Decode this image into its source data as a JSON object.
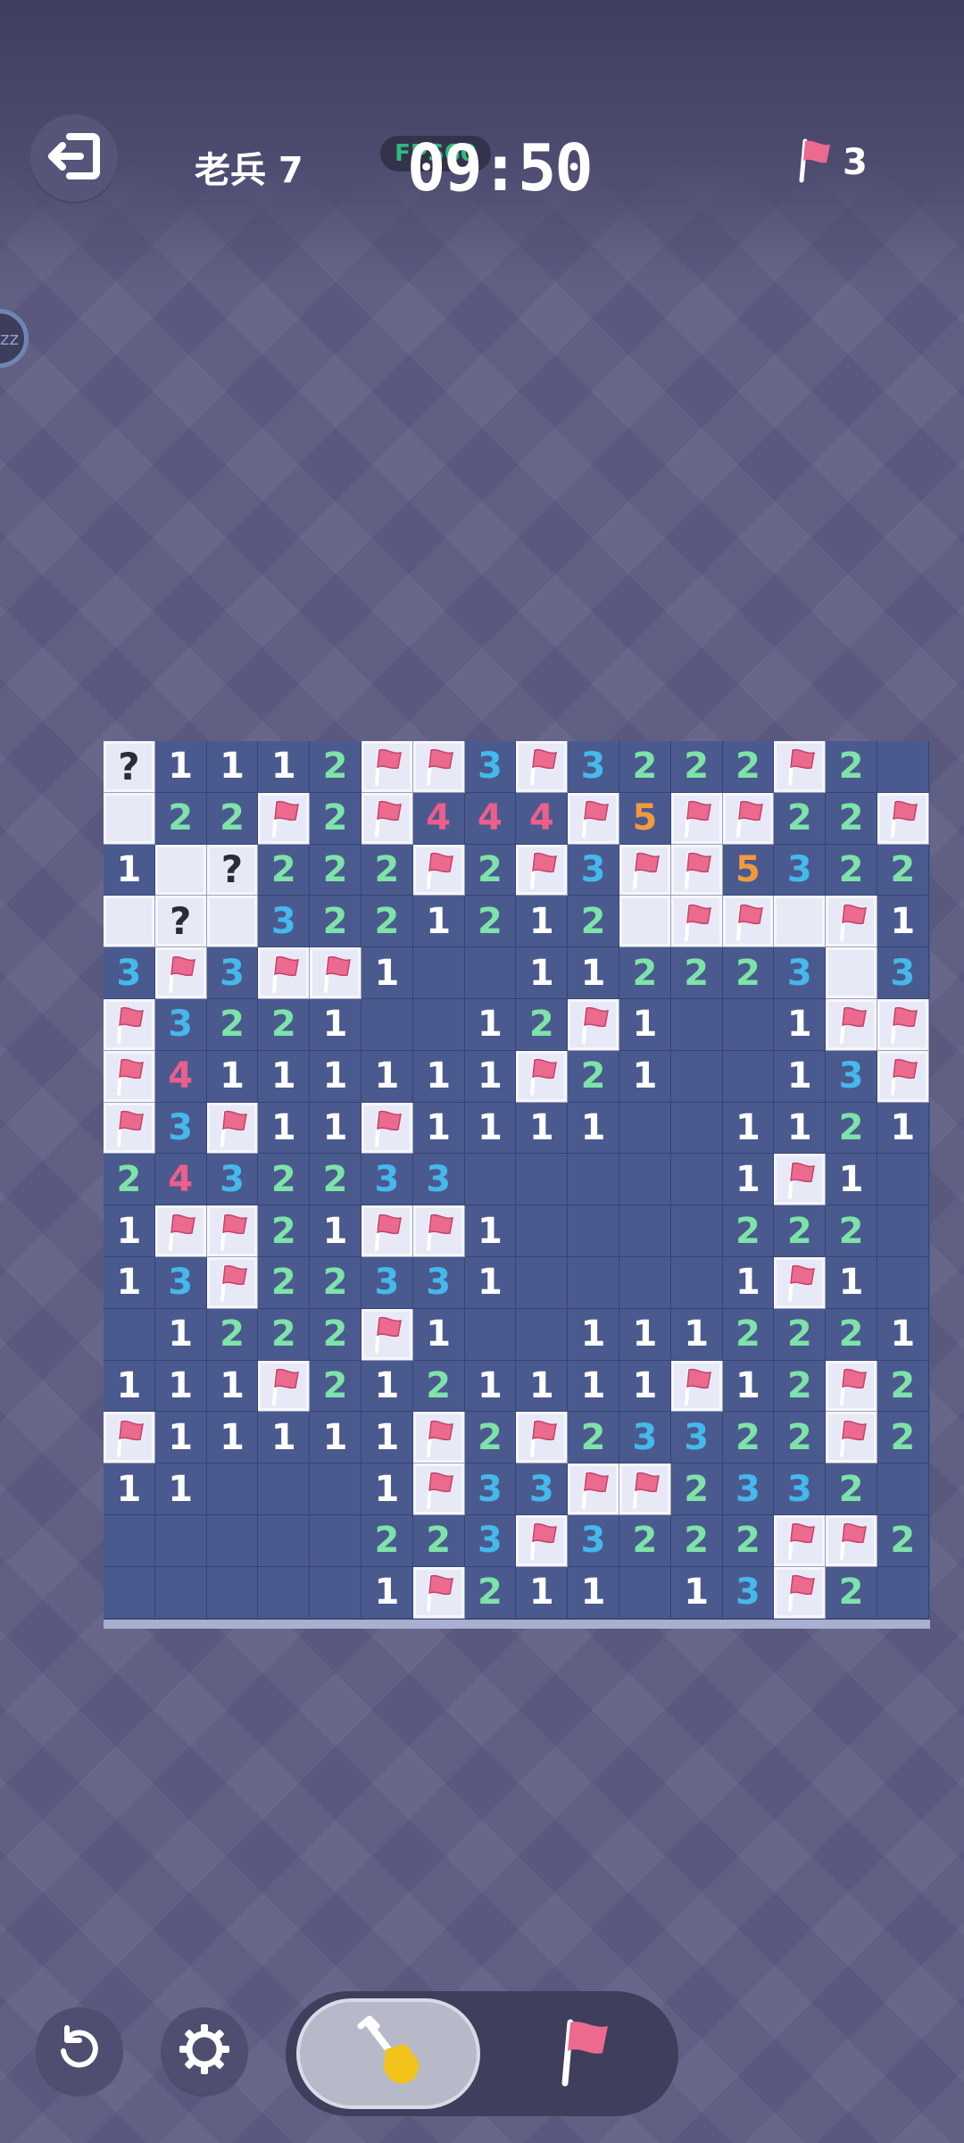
{
  "header": {
    "level_label": "老兵 7",
    "fps_label": "FPS60",
    "timer": "09:50",
    "flag_count": "3"
  },
  "icons": {
    "exit": "exit-icon",
    "flag": "flag-icon",
    "restart": "restart-icon",
    "settings": "gear-icon",
    "shovel": "shovel-icon",
    "idle": "zz-icon"
  },
  "colors": {
    "board": "#4a5a8e",
    "closed_cell": "#e7e9f6",
    "n1": "#ffffff",
    "n2": "#7ee3a8",
    "n3": "#45b8ec",
    "n4": "#ec5e8c",
    "n5": "#f29a3e",
    "flag": "#ec6a8e"
  },
  "idle_indicator": "zz",
  "board": {
    "columns": 16,
    "rows": 17,
    "legend": "digit = opened number, '.' = opened empty, 'F' = flagged, '?' = question mark, '#' = unopened",
    "cells": [
      "?1112FF3F3222F2",
      "#22F2F444F5FF22F",
      "1#?222F2F3FF5322",
      "#?#3221212#FF#F1",
      "3F3FF1..112223#3",
      "F3221..12F1..1FF",
      "F4111111F21..13F",
      "F3F11F1111..1121",
      "2432233.....1F1.",
      "1FF21FF1....222.",
      "13F22331....1F1.",
      ".1222F1..1112221.",
      "111F2121111F12F2.",
      "F11111F2F23322F2.",
      "11...1F33FF2332.",
      ".....223F3222FF2.",
      ".....1F211.13F2."
    ]
  },
  "controls": {
    "mode_selected": "dig"
  }
}
